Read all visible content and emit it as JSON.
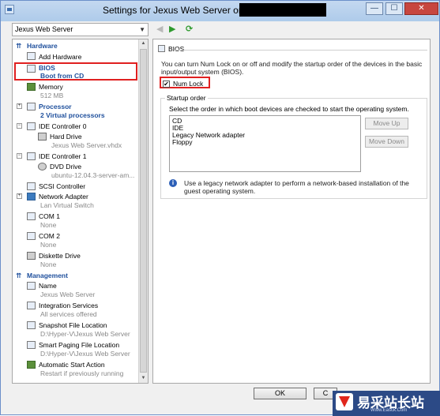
{
  "window": {
    "title": "Settings for Jexus Web Server on",
    "minimize": "—",
    "maximize": "☐",
    "close": "✕"
  },
  "vm_selector": {
    "value": "Jexus Web Server"
  },
  "nav": {
    "back": "◀",
    "forward": "▶",
    "refresh": "⟳"
  },
  "sidebar": {
    "hardware_header": "Hardware",
    "add_hardware": "Add Hardware",
    "bios": {
      "label": "BIOS",
      "sub": "Boot from CD"
    },
    "memory": {
      "label": "Memory",
      "sub": "512 MB"
    },
    "processor": {
      "label": "Processor",
      "sub": "2 Virtual processors"
    },
    "ide0": {
      "label": "IDE Controller 0",
      "child": "Hard Drive",
      "child_sub": "Jexus Web Server.vhdx"
    },
    "ide1": {
      "label": "IDE Controller 1",
      "child": "DVD Drive",
      "child_sub": "ubuntu-12.04.3-server-am..."
    },
    "scsi": "SCSI Controller",
    "network": {
      "label": "Network Adapter",
      "sub": "Lan Virtual Switch"
    },
    "com1": {
      "label": "COM 1",
      "sub": "None"
    },
    "com2": {
      "label": "COM 2",
      "sub": "None"
    },
    "diskette": {
      "label": "Diskette Drive",
      "sub": "None"
    },
    "management_header": "Management",
    "name": {
      "label": "Name",
      "sub": "Jexus Web Server"
    },
    "integration": {
      "label": "Integration Services",
      "sub": "All services offered"
    },
    "snapshot": {
      "label": "Snapshot File Location",
      "sub": "D:\\Hyper-V\\Jexus Web Server"
    },
    "smartpaging": {
      "label": "Smart Paging File Location",
      "sub": "D:\\Hyper-V\\Jexus Web Server"
    },
    "autostart": {
      "label": "Automatic Start Action",
      "sub": "Restart if previously running"
    }
  },
  "bios_panel": {
    "header": "BIOS",
    "description": "You can turn Num Lock on or off and modify the startup order of the devices in the basic input/output system (BIOS).",
    "numlock_label": "Num Lock",
    "numlock_checked": true,
    "startup_group": "Startup order",
    "startup_desc": "Select the order in which boot devices are checked to start the operating system.",
    "boot_devices": [
      "CD",
      "IDE",
      "Legacy Network adapter",
      "Floppy"
    ],
    "move_up": "Move Up",
    "move_down": "Move Down",
    "info": "Use a legacy network adapter to perform a network-based installation of the guest operating system."
  },
  "dialog": {
    "ok": "OK",
    "cancel": "C"
  },
  "watermark": {
    "text": "易采站长站",
    "sub": "Www.Easck.Com"
  }
}
